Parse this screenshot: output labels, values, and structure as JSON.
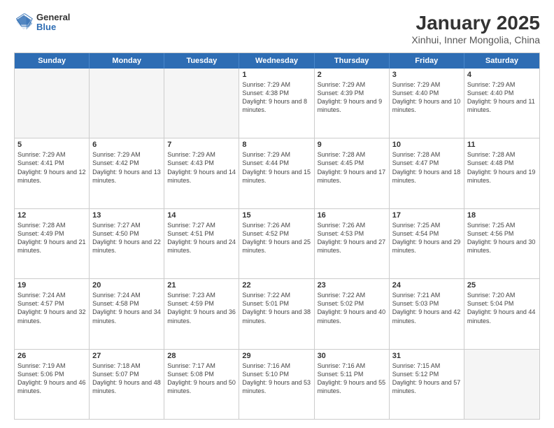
{
  "header": {
    "logo_line1": "General",
    "logo_line2": "Blue",
    "title": "January 2025",
    "subtitle": "Xinhui, Inner Mongolia, China"
  },
  "days_of_week": [
    "Sunday",
    "Monday",
    "Tuesday",
    "Wednesday",
    "Thursday",
    "Friday",
    "Saturday"
  ],
  "rows": [
    {
      "cells": [
        {
          "day": "",
          "info": "",
          "shaded": true
        },
        {
          "day": "",
          "info": "",
          "shaded": true
        },
        {
          "day": "",
          "info": "",
          "shaded": true
        },
        {
          "day": "1",
          "info": "Sunrise: 7:29 AM\nSunset: 4:38 PM\nDaylight: 9 hours\nand 8 minutes.",
          "shaded": false
        },
        {
          "day": "2",
          "info": "Sunrise: 7:29 AM\nSunset: 4:39 PM\nDaylight: 9 hours\nand 9 minutes.",
          "shaded": false
        },
        {
          "day": "3",
          "info": "Sunrise: 7:29 AM\nSunset: 4:40 PM\nDaylight: 9 hours\nand 10 minutes.",
          "shaded": false
        },
        {
          "day": "4",
          "info": "Sunrise: 7:29 AM\nSunset: 4:40 PM\nDaylight: 9 hours\nand 11 minutes.",
          "shaded": false
        }
      ]
    },
    {
      "cells": [
        {
          "day": "5",
          "info": "Sunrise: 7:29 AM\nSunset: 4:41 PM\nDaylight: 9 hours\nand 12 minutes.",
          "shaded": false
        },
        {
          "day": "6",
          "info": "Sunrise: 7:29 AM\nSunset: 4:42 PM\nDaylight: 9 hours\nand 13 minutes.",
          "shaded": false
        },
        {
          "day": "7",
          "info": "Sunrise: 7:29 AM\nSunset: 4:43 PM\nDaylight: 9 hours\nand 14 minutes.",
          "shaded": false
        },
        {
          "day": "8",
          "info": "Sunrise: 7:29 AM\nSunset: 4:44 PM\nDaylight: 9 hours\nand 15 minutes.",
          "shaded": false
        },
        {
          "day": "9",
          "info": "Sunrise: 7:28 AM\nSunset: 4:45 PM\nDaylight: 9 hours\nand 17 minutes.",
          "shaded": false
        },
        {
          "day": "10",
          "info": "Sunrise: 7:28 AM\nSunset: 4:47 PM\nDaylight: 9 hours\nand 18 minutes.",
          "shaded": false
        },
        {
          "day": "11",
          "info": "Sunrise: 7:28 AM\nSunset: 4:48 PM\nDaylight: 9 hours\nand 19 minutes.",
          "shaded": false
        }
      ]
    },
    {
      "cells": [
        {
          "day": "12",
          "info": "Sunrise: 7:28 AM\nSunset: 4:49 PM\nDaylight: 9 hours\nand 21 minutes.",
          "shaded": false
        },
        {
          "day": "13",
          "info": "Sunrise: 7:27 AM\nSunset: 4:50 PM\nDaylight: 9 hours\nand 22 minutes.",
          "shaded": false
        },
        {
          "day": "14",
          "info": "Sunrise: 7:27 AM\nSunset: 4:51 PM\nDaylight: 9 hours\nand 24 minutes.",
          "shaded": false
        },
        {
          "day": "15",
          "info": "Sunrise: 7:26 AM\nSunset: 4:52 PM\nDaylight: 9 hours\nand 25 minutes.",
          "shaded": false
        },
        {
          "day": "16",
          "info": "Sunrise: 7:26 AM\nSunset: 4:53 PM\nDaylight: 9 hours\nand 27 minutes.",
          "shaded": false
        },
        {
          "day": "17",
          "info": "Sunrise: 7:25 AM\nSunset: 4:54 PM\nDaylight: 9 hours\nand 29 minutes.",
          "shaded": false
        },
        {
          "day": "18",
          "info": "Sunrise: 7:25 AM\nSunset: 4:56 PM\nDaylight: 9 hours\nand 30 minutes.",
          "shaded": false
        }
      ]
    },
    {
      "cells": [
        {
          "day": "19",
          "info": "Sunrise: 7:24 AM\nSunset: 4:57 PM\nDaylight: 9 hours\nand 32 minutes.",
          "shaded": false
        },
        {
          "day": "20",
          "info": "Sunrise: 7:24 AM\nSunset: 4:58 PM\nDaylight: 9 hours\nand 34 minutes.",
          "shaded": false
        },
        {
          "day": "21",
          "info": "Sunrise: 7:23 AM\nSunset: 4:59 PM\nDaylight: 9 hours\nand 36 minutes.",
          "shaded": false
        },
        {
          "day": "22",
          "info": "Sunrise: 7:22 AM\nSunset: 5:01 PM\nDaylight: 9 hours\nand 38 minutes.",
          "shaded": false
        },
        {
          "day": "23",
          "info": "Sunrise: 7:22 AM\nSunset: 5:02 PM\nDaylight: 9 hours\nand 40 minutes.",
          "shaded": false
        },
        {
          "day": "24",
          "info": "Sunrise: 7:21 AM\nSunset: 5:03 PM\nDaylight: 9 hours\nand 42 minutes.",
          "shaded": false
        },
        {
          "day": "25",
          "info": "Sunrise: 7:20 AM\nSunset: 5:04 PM\nDaylight: 9 hours\nand 44 minutes.",
          "shaded": false
        }
      ]
    },
    {
      "cells": [
        {
          "day": "26",
          "info": "Sunrise: 7:19 AM\nSunset: 5:06 PM\nDaylight: 9 hours\nand 46 minutes.",
          "shaded": false
        },
        {
          "day": "27",
          "info": "Sunrise: 7:18 AM\nSunset: 5:07 PM\nDaylight: 9 hours\nand 48 minutes.",
          "shaded": false
        },
        {
          "day": "28",
          "info": "Sunrise: 7:17 AM\nSunset: 5:08 PM\nDaylight: 9 hours\nand 50 minutes.",
          "shaded": false
        },
        {
          "day": "29",
          "info": "Sunrise: 7:16 AM\nSunset: 5:10 PM\nDaylight: 9 hours\nand 53 minutes.",
          "shaded": false
        },
        {
          "day": "30",
          "info": "Sunrise: 7:16 AM\nSunset: 5:11 PM\nDaylight: 9 hours\nand 55 minutes.",
          "shaded": false
        },
        {
          "day": "31",
          "info": "Sunrise: 7:15 AM\nSunset: 5:12 PM\nDaylight: 9 hours\nand 57 minutes.",
          "shaded": false
        },
        {
          "day": "",
          "info": "",
          "shaded": true
        }
      ]
    }
  ]
}
